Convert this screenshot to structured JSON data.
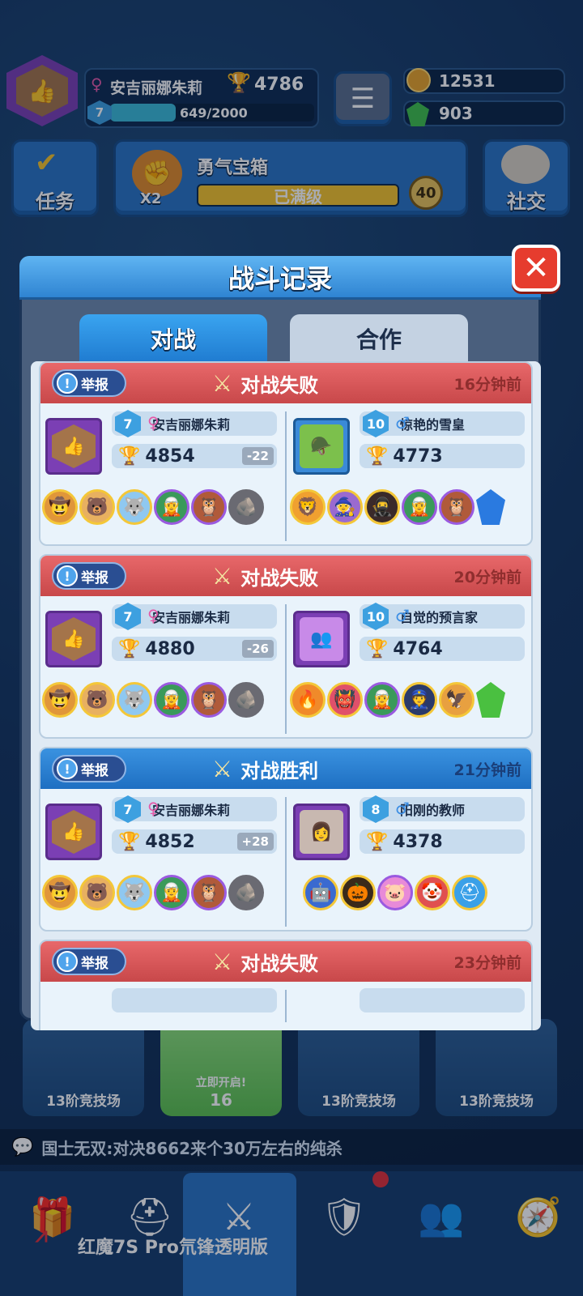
{
  "player": {
    "name": "安吉丽娜朱莉",
    "trophies": "4786",
    "level": "7",
    "xp": "649/2000"
  },
  "currency": {
    "coins": "12531",
    "gems": "903"
  },
  "top_buttons": {
    "tasks": "任务",
    "chest_title": "勇气宝箱",
    "chest_status": "已满级",
    "chest_multiplier": "X2",
    "chest_count": "40",
    "social": "社交"
  },
  "modal": {
    "title": "战斗记录",
    "close": "✕",
    "tabs": [
      "对战",
      "合作"
    ]
  },
  "report_label": "举报",
  "battles": [
    {
      "result": "对战失败",
      "outcome": "lose",
      "time": "16分钟前",
      "me": {
        "level": "7",
        "name": "安吉丽娜朱莉",
        "trophies": "4854",
        "delta": "-22"
      },
      "opp": {
        "level": "10",
        "name": "惊艳的雪皇",
        "trophies": "4773"
      }
    },
    {
      "result": "对战失败",
      "outcome": "lose",
      "time": "20分钟前",
      "me": {
        "level": "7",
        "name": "安吉丽娜朱莉",
        "trophies": "4880",
        "delta": "-26"
      },
      "opp": {
        "level": "10",
        "name": "自觉的预言家",
        "trophies": "4764"
      }
    },
    {
      "result": "对战胜利",
      "outcome": "win",
      "time": "21分钟前",
      "me": {
        "level": "7",
        "name": "安吉丽娜朱莉",
        "trophies": "4852",
        "delta": "+28"
      },
      "opp": {
        "level": "8",
        "name": "阳刚的教师",
        "trophies": "4378"
      }
    },
    {
      "result": "对战失败",
      "outcome": "lose",
      "time": "23分钟前"
    }
  ],
  "chests": {
    "arena_label": "13阶竞技场",
    "open_now": "立即开启!",
    "open_cost": "16"
  },
  "chat_message": "国士无双:对决8662来个30万左右的纯杀",
  "watermark": "红魔7S Pro氘锋透明版",
  "colors": {
    "lose": "#d0504f",
    "win": "#2a7fd0",
    "accent": "#f5c42c"
  }
}
